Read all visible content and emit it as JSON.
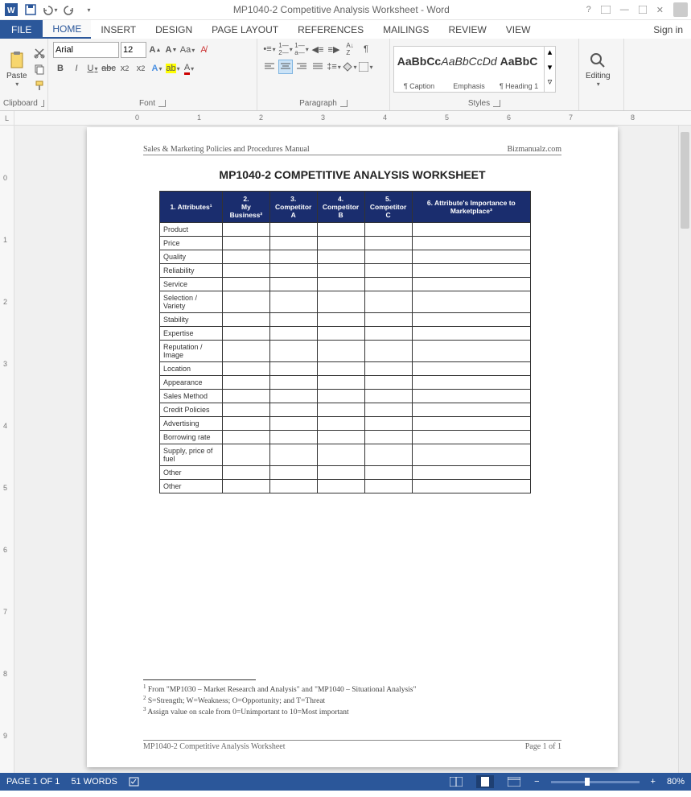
{
  "titlebar": {
    "title": "MP1040-2 Competitive Analysis Worksheet - Word"
  },
  "file_tab": "FILE",
  "tabs": [
    "HOME",
    "INSERT",
    "DESIGN",
    "PAGE LAYOUT",
    "REFERENCES",
    "MAILINGS",
    "REVIEW",
    "VIEW"
  ],
  "signin": "Sign in",
  "clipboard": {
    "paste": "Paste",
    "label": "Clipboard"
  },
  "font": {
    "name": "Arial",
    "size": "12",
    "label": "Font"
  },
  "paragraph": {
    "label": "Paragraph"
  },
  "styles": {
    "label": "Styles",
    "items": [
      {
        "preview": "AaBbCc",
        "name": "¶ Caption",
        "bold": true
      },
      {
        "preview": "AaBbCcDd",
        "name": "Emphasis",
        "italic": true
      },
      {
        "preview": "AaBbC",
        "name": "¶ Heading 1",
        "bold": true
      }
    ]
  },
  "editing": {
    "label": "Editing"
  },
  "document": {
    "header_left": "Sales & Marketing Policies and Procedures Manual",
    "header_right": "Bizmanualz.com",
    "title": "MP1040-2 COMPETITIVE ANALYSIS WORKSHEET",
    "columns": [
      "1. Attributes¹",
      "2.\nMy Business²",
      "3.\nCompetitor A",
      "4.\nCompetitor B",
      "5.\nCompetitor C",
      "6. Attribute's Importance to Marketplace³"
    ],
    "rows": [
      "Product",
      "Price",
      "Quality",
      "Reliability",
      "Service",
      "Selection / Variety",
      "Stability",
      "Expertise",
      "Reputation / Image",
      "Location",
      "Appearance",
      "Sales Method",
      "Credit Policies",
      "Advertising",
      "Borrowing rate",
      "Supply, price of fuel",
      "Other",
      "Other"
    ],
    "footnotes": [
      "From \"MP1030 – Market Research and Analysis\" and \"MP1040 – Situational Analysis\"",
      "S=Strength; W=Weakness; O=Opportunity; and T=Threat",
      "Assign value on scale from 0=Unimportant to 10=Most important"
    ],
    "footer_left": "MP1040-2 Competitive Analysis Worksheet",
    "footer_right": "Page 1 of 1"
  },
  "status": {
    "page": "PAGE 1 OF 1",
    "words": "51 WORDS",
    "zoom": "80%"
  }
}
